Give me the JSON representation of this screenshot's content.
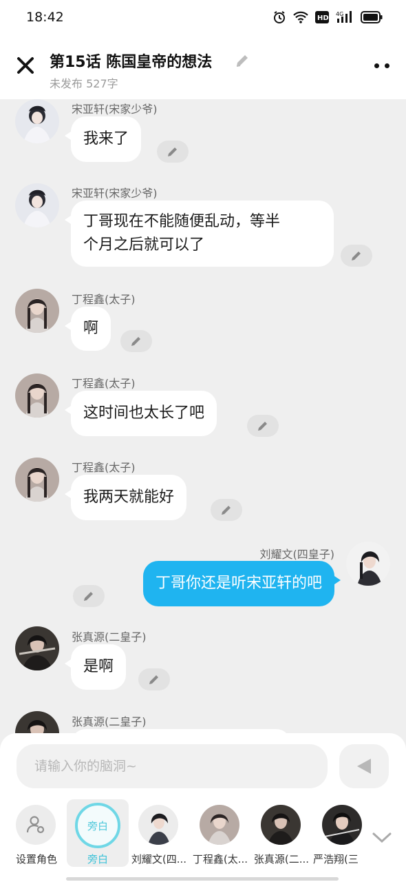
{
  "status": {
    "time": "18:42"
  },
  "header": {
    "title": "第15话 陈国皇帝的想法",
    "subtitle": "未发布 527字"
  },
  "messages": [
    {
      "name": "宋亚轩(宋家少爷)",
      "text": "我来了"
    },
    {
      "name": "宋亚轩(宋家少爷)",
      "line1": "丁哥现在不能随便乱动，等半",
      "line2": "个月之后就可以了"
    },
    {
      "name": "丁程鑫(太子)",
      "text": "啊"
    },
    {
      "name": "丁程鑫(太子)",
      "text": "这时间也太长了吧"
    },
    {
      "name": "丁程鑫(太子)",
      "text": "我两天就能好"
    },
    {
      "name": "刘耀文(四皇子)",
      "text": "丁哥你还是听宋亚轩的吧"
    },
    {
      "name": "张真源(二皇子)",
      "text": "是啊"
    },
    {
      "name": "张真源(二皇子)"
    }
  ],
  "input": {
    "placeholder": "请输入你的脑洞~"
  },
  "characters": [
    {
      "label": "设置角色"
    },
    {
      "label": "旁白",
      "badge": "旁白"
    },
    {
      "label": "刘耀文(四..."
    },
    {
      "label": "丁程鑫(太..."
    },
    {
      "label": "张真源(二..."
    },
    {
      "label": "严浩翔(三"
    }
  ],
  "colors": {
    "accent": "#1fb4f0",
    "narrator": "#4cc7da"
  }
}
